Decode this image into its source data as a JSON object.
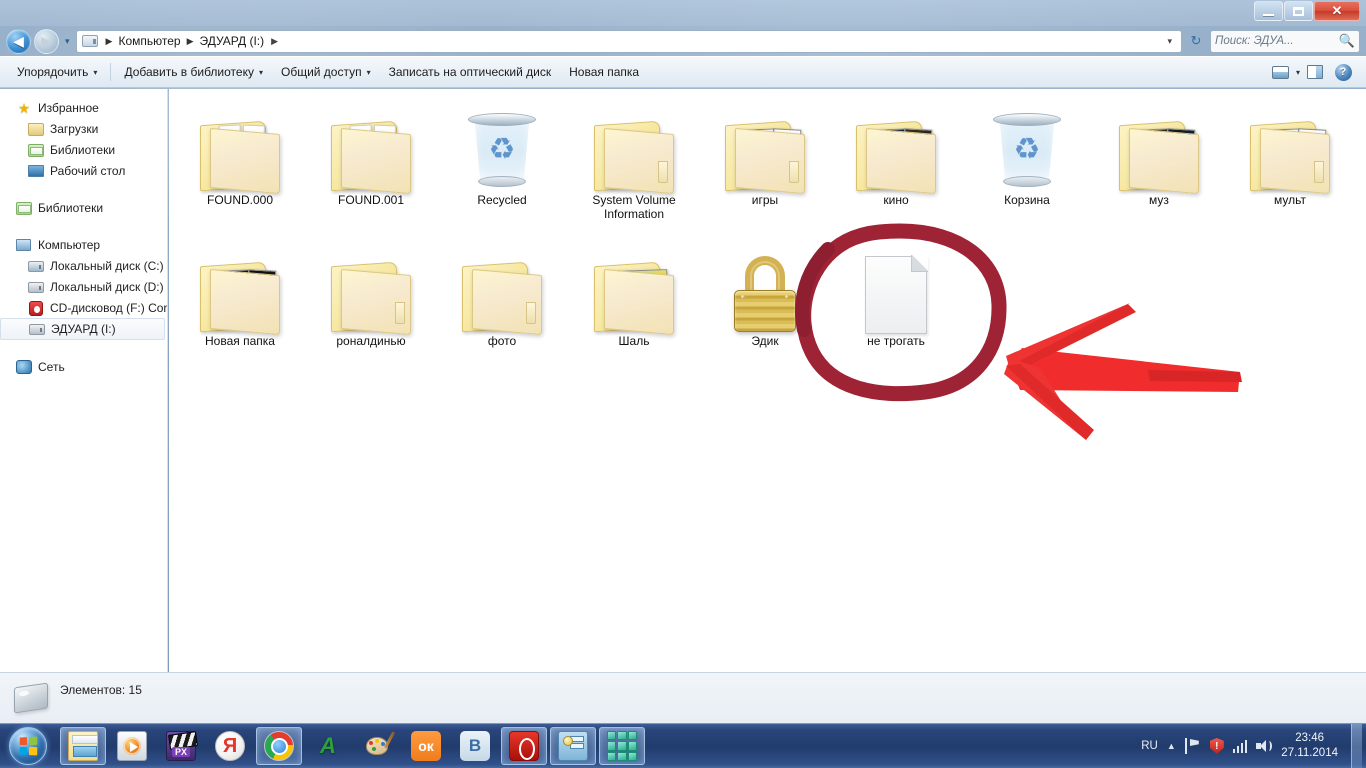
{
  "window": {
    "minimize_label": "—",
    "maximize_label": "",
    "close_label": "✕"
  },
  "navigation": {
    "back_label": "◀",
    "forward_label": "▶",
    "recent_label": "▾",
    "refresh_label": "↻",
    "breadcrumb": {
      "root_icon": "drive-icon",
      "items": [
        "Компьютер",
        "ЭДУАРД (I:)"
      ],
      "separator": "▶",
      "dropdown": "▾"
    }
  },
  "search": {
    "placeholder": "Поиск: ЭДУА...",
    "value": "",
    "icon": "search-icon"
  },
  "toolbar": {
    "items": [
      {
        "label": "Упорядочить",
        "caret": "▾"
      },
      {
        "label": "Добавить в библиотеку",
        "caret": "▾"
      },
      {
        "label": "Общий доступ",
        "caret": "▾"
      },
      {
        "label": "Записать на оптический диск",
        "caret": ""
      },
      {
        "label": "Новая папка",
        "caret": ""
      }
    ],
    "views_caret": "▾",
    "help_label": "?"
  },
  "sidebar": {
    "groups": [
      {
        "header": {
          "label": "Избранное",
          "icon": "star-icon"
        },
        "items": [
          {
            "label": "Загрузки",
            "icon": "downloads-icon"
          },
          {
            "label": "Библиотеки",
            "icon": "library-folder-icon"
          },
          {
            "label": "Рабочий стол",
            "icon": "desktop-icon"
          }
        ]
      },
      {
        "header": {
          "label": "Библиотеки",
          "icon": "library-icon"
        },
        "items": []
      },
      {
        "header": {
          "label": "Компьютер",
          "icon": "computer-icon"
        },
        "items": [
          {
            "label": "Локальный диск (C:)",
            "icon": "system-drive-icon",
            "selected": false
          },
          {
            "label": "Локальный диск (D:)",
            "icon": "hard-drive-icon",
            "selected": false
          },
          {
            "label": "CD-дисковод (F:) Cor",
            "icon": "cd-drive-icon",
            "selected": false
          },
          {
            "label": "ЭДУАРД (I:)",
            "icon": "removable-drive-icon",
            "selected": true
          }
        ]
      },
      {
        "header": {
          "label": "Сеть",
          "icon": "network-icon"
        },
        "items": []
      }
    ]
  },
  "files": {
    "items": [
      {
        "name": "FOUND.000",
        "icon": "folder-with-documents",
        "row": 0,
        "col": 0
      },
      {
        "name": "FOUND.001",
        "icon": "folder-with-documents",
        "row": 0,
        "col": 1
      },
      {
        "name": "Recycled",
        "icon": "recycle-bin",
        "row": 0,
        "col": 2
      },
      {
        "name": "System Volume Information",
        "icon": "folder-empty",
        "row": 0,
        "col": 3
      },
      {
        "name": "игры",
        "icon": "folder-with-papers",
        "row": 0,
        "col": 4
      },
      {
        "name": "кино",
        "icon": "folder-with-video",
        "row": 0,
        "col": 5
      },
      {
        "name": "Корзина",
        "icon": "recycle-bin",
        "row": 0,
        "col": 6
      },
      {
        "name": "муз",
        "icon": "folder-with-media",
        "row": 0,
        "col": 7
      },
      {
        "name": "мульт",
        "icon": "folder-with-papers",
        "row": 0,
        "col": 8
      },
      {
        "name": "Новая папка",
        "icon": "folder-with-dark-media",
        "row": 1,
        "col": 0
      },
      {
        "name": "роналдинью",
        "icon": "folder-empty",
        "row": 1,
        "col": 1
      },
      {
        "name": "фото",
        "icon": "folder-empty",
        "row": 1,
        "col": 2
      },
      {
        "name": "Шаль",
        "icon": "folder-with-picture",
        "row": 1,
        "col": 3
      },
      {
        "name": "Эдик",
        "icon": "padlock",
        "row": 1,
        "col": 4
      },
      {
        "name": "не трогать",
        "icon": "blank-document",
        "row": 1,
        "col": 5
      }
    ]
  },
  "annotations": {
    "circle": {
      "target": "не трогать",
      "color": "#9e2335"
    },
    "arrow": {
      "direction": "left",
      "color": "#f02c2c"
    }
  },
  "statusbar": {
    "text": "Элементов: 15",
    "icon": "removable-drive-icon"
  },
  "taskbar": {
    "start_label": "Пуск",
    "buttons": [
      {
        "name": "explorer",
        "icon": "explorer-icon",
        "label": "",
        "active": true
      },
      {
        "name": "media-player",
        "icon": "media-player-icon",
        "label": "",
        "active": false
      },
      {
        "name": "px-movie",
        "icon": "movie-editor-icon",
        "label": "PX",
        "active": false
      },
      {
        "name": "yandex-browser",
        "icon": "yandex-icon",
        "label": "Я",
        "active": false
      },
      {
        "name": "chrome",
        "icon": "chrome-icon",
        "label": "",
        "active": true
      },
      {
        "name": "amigo",
        "icon": "amigo-icon",
        "label": "A",
        "active": false
      },
      {
        "name": "paint",
        "icon": "paint-icon",
        "label": "",
        "active": false
      },
      {
        "name": "odnoklassniki",
        "icon": "odnoklassniki-icon",
        "label": "ок",
        "active": false
      },
      {
        "name": "vkontakte",
        "icon": "vkontakte-icon",
        "label": "B",
        "active": false
      },
      {
        "name": "opera",
        "icon": "opera-icon",
        "label": "",
        "active": true
      },
      {
        "name": "control-panel",
        "icon": "settings-icon",
        "label": "",
        "active": true
      },
      {
        "name": "gems-game",
        "icon": "gems-icon",
        "label": "",
        "active": true
      }
    ],
    "tray": {
      "language": "RU",
      "expand": "▲",
      "icons": [
        "flag-icon",
        "security-shield-icon",
        "network-signal-icon",
        "volume-icon"
      ],
      "time": "23:46",
      "date": "27.11.2014"
    }
  }
}
